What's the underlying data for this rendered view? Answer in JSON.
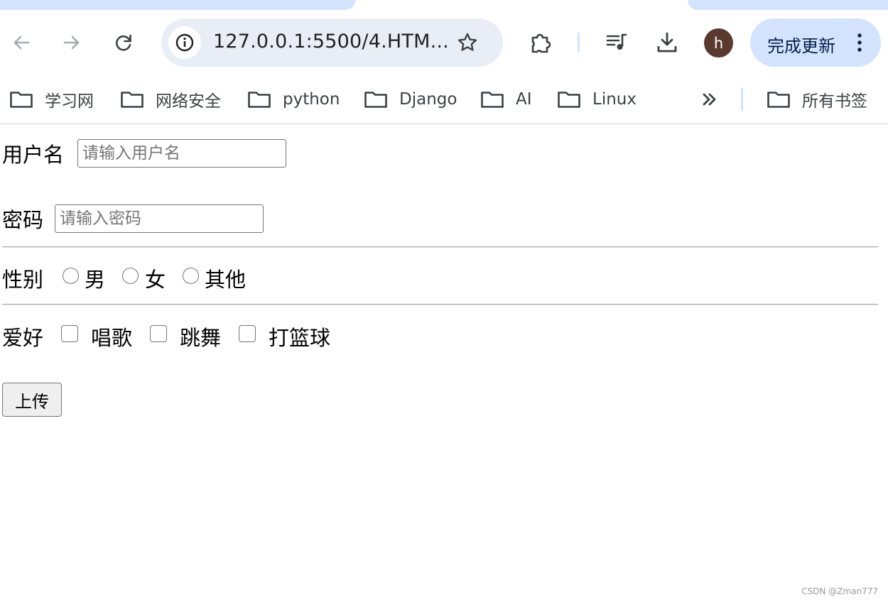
{
  "browser": {
    "url": "127.0.0.1:5500/4.HTM...",
    "profile_initial": "h",
    "update_button_label": "完成更新",
    "accent_color": "#d3e3fd",
    "omnibox_color": "#e9eef6",
    "avatar_color": "#5a3a2e"
  },
  "bookmarks": {
    "items": [
      {
        "label": "学习网",
        "icon": "folder-icon"
      },
      {
        "label": "网络安全",
        "icon": "folder-icon"
      },
      {
        "label": "python",
        "icon": "folder-icon"
      },
      {
        "label": "Django",
        "icon": "folder-icon"
      },
      {
        "label": "AI",
        "icon": "folder-icon"
      },
      {
        "label": "Linux",
        "icon": "folder-icon"
      }
    ],
    "overflow_icon": "chevron-double-right-icon",
    "all_bookmarks_label": "所有书签"
  },
  "form": {
    "username_label": "用户名",
    "username_placeholder": "请输入用户名",
    "password_label": "密码",
    "password_placeholder": "请输入密码",
    "gender_label": "性别",
    "gender_options": [
      "男",
      "女",
      "其他"
    ],
    "hobby_label": "爱好",
    "hobby_options": [
      "唱歌",
      "跳舞",
      "打篮球"
    ],
    "submit_label": "上传"
  },
  "watermark": "CSDN @Zman777"
}
